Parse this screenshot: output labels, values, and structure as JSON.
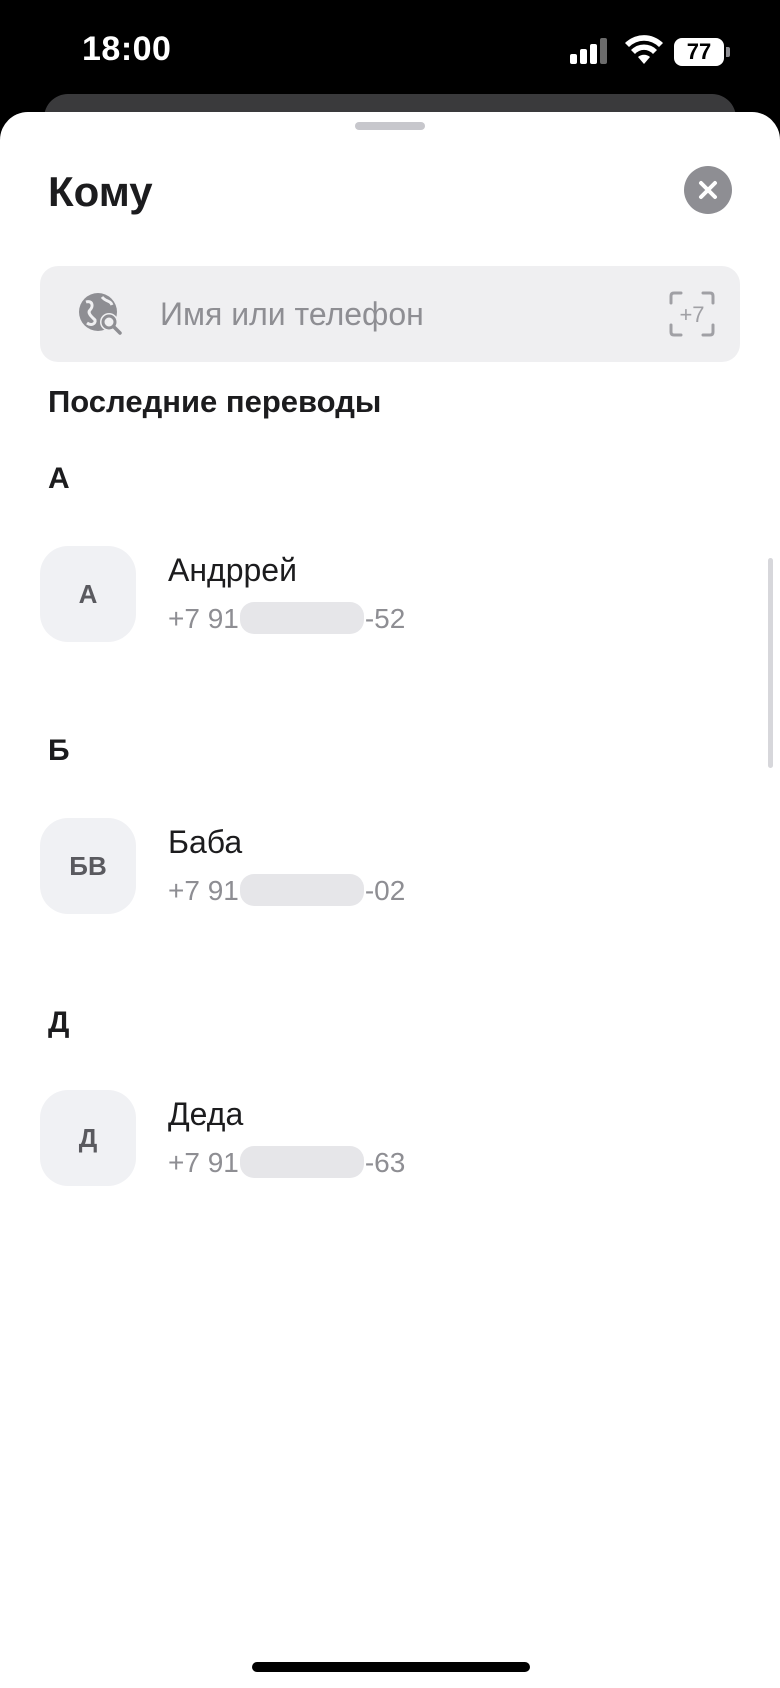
{
  "status_bar": {
    "time": "18:00",
    "battery_level": "77"
  },
  "sheet": {
    "title": "Кому",
    "search": {
      "placeholder": "Имя или телефон",
      "value": ""
    },
    "recent_heading": "Последние переводы",
    "groups": [
      {
        "letter": "А",
        "contacts": [
          {
            "initials": "А",
            "name": "Андррей",
            "phone_prefix": "+7 91",
            "phone_suffix": "-52"
          }
        ]
      },
      {
        "letter": "Б",
        "contacts": [
          {
            "initials": "БВ",
            "name": "Баба",
            "phone_prefix": "+7 91",
            "phone_suffix": "-02"
          }
        ]
      },
      {
        "letter": "Д",
        "contacts": [
          {
            "initials": "Д",
            "name": "Деда",
            "phone_prefix": "+7 91",
            "phone_suffix": "-63"
          }
        ]
      }
    ]
  },
  "icons": {
    "close": "close-icon",
    "search": "globe-search-icon",
    "scan": "scan-phone-icon"
  },
  "colors": {
    "sheet_bg": "#ffffff",
    "search_bg": "#efeff1",
    "avatar_bg": "#f0f1f4",
    "secondary_text": "#8e8e93"
  }
}
